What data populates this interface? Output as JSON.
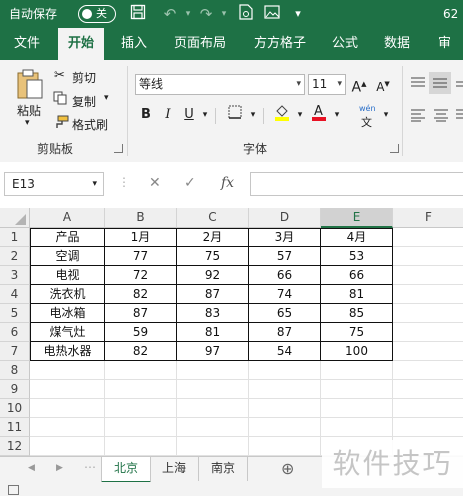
{
  "titlebar": {
    "autosave_label": "自动保存",
    "autosave_state": "关",
    "right_text": "62"
  },
  "tabs": [
    {
      "label": "文件"
    },
    {
      "label": "开始"
    },
    {
      "label": "插入"
    },
    {
      "label": "页面布局"
    },
    {
      "label": "方方格子"
    },
    {
      "label": "公式"
    },
    {
      "label": "数据"
    },
    {
      "label": "审阅"
    }
  ],
  "ribbon": {
    "clipboard": {
      "paste": "粘贴",
      "cut": "剪切",
      "copy": "复制",
      "format_painter": "格式刷",
      "group": "剪贴板"
    },
    "font": {
      "name": "等线",
      "size": "11",
      "group": "字体",
      "bold": "B",
      "italic": "I",
      "underline": "U",
      "grow": "A",
      "shrink": "A",
      "wen": "wén",
      "wen2": "文",
      "fill_color": "#ffff00",
      "font_color": "#e81123"
    }
  },
  "formula_bar": {
    "name_box": "E13",
    "fx": "fx",
    "cancel": "✕",
    "enter": "✓",
    "dots": "⋮",
    "formula": ""
  },
  "grid": {
    "columns": [
      "A",
      "B",
      "C",
      "D",
      "E",
      "F"
    ],
    "selected_column": "E",
    "rows": [
      "1",
      "2",
      "3",
      "4",
      "5",
      "6",
      "7",
      "8",
      "9",
      "10",
      "11",
      "12"
    ],
    "table": [
      [
        "产品",
        "1月",
        "2月",
        "3月",
        "4月"
      ],
      [
        "空调",
        "77",
        "75",
        "57",
        "53"
      ],
      [
        "电视",
        "72",
        "92",
        "66",
        "66"
      ],
      [
        "洗衣机",
        "82",
        "87",
        "74",
        "81"
      ],
      [
        "电冰箱",
        "87",
        "83",
        "65",
        "85"
      ],
      [
        "煤气灶",
        "59",
        "81",
        "87",
        "75"
      ],
      [
        "电热水器",
        "82",
        "97",
        "54",
        "100"
      ]
    ]
  },
  "sheets": [
    {
      "label": "北京"
    },
    {
      "label": "上海"
    },
    {
      "label": "南京"
    }
  ],
  "active_sheet": "北京",
  "watermark": "软件技巧",
  "colors": {
    "brand": "#1e7145",
    "accent": "#217346"
  }
}
